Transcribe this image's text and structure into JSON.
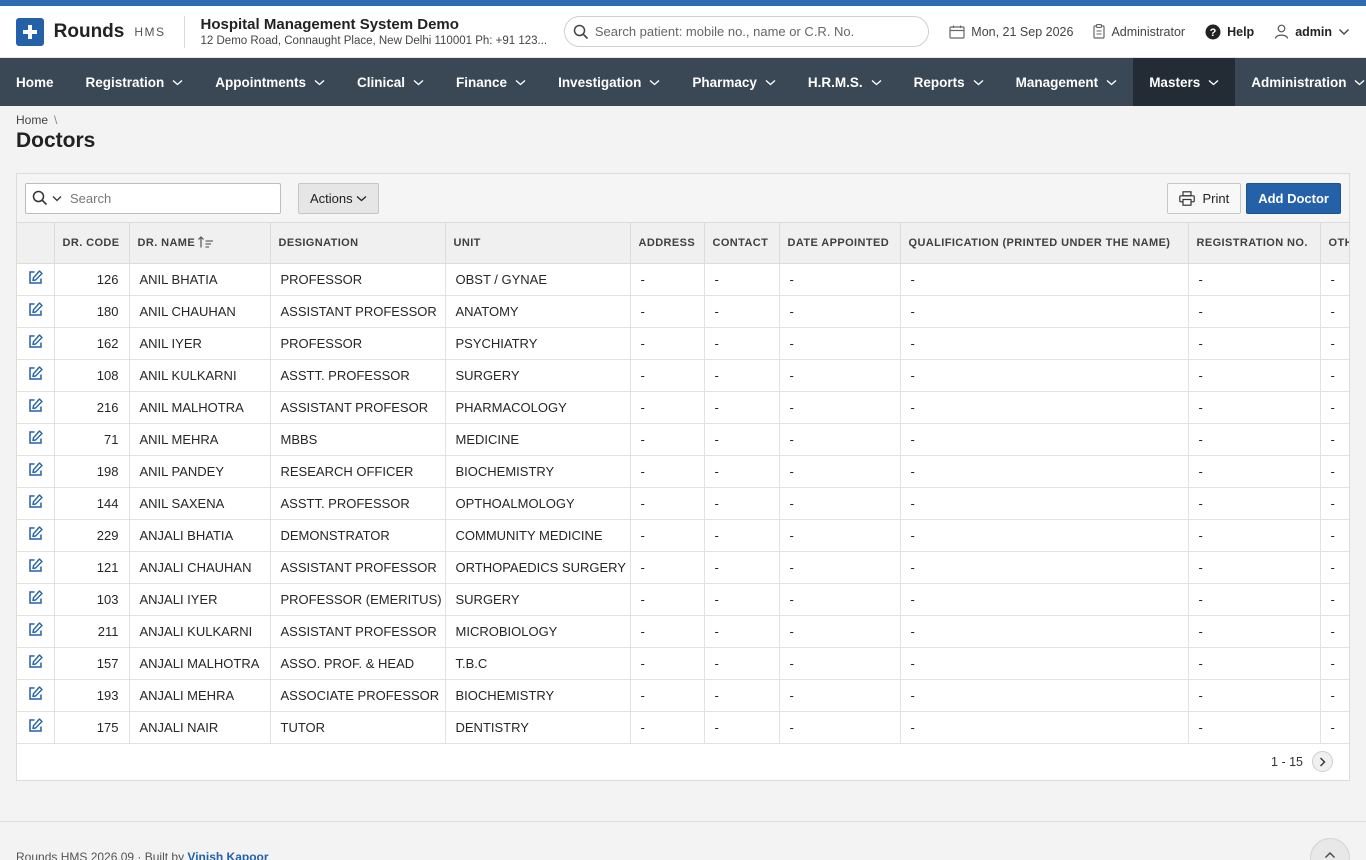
{
  "app": {
    "name": "Rounds",
    "suffix": "HMS"
  },
  "hospital": {
    "name": "Hospital Management System Demo",
    "address": "12 Demo Road, Connaught Place, New Delhi 110001 Ph: +91 123..."
  },
  "header": {
    "search_placeholder": "Search patient: mobile no., name or C.R. No.",
    "date": "Mon, 21 Sep 2026",
    "role": "Administrator",
    "help": "Help",
    "user": "admin"
  },
  "nav": {
    "items": [
      {
        "label": "Home",
        "caret": false,
        "active": false
      },
      {
        "label": "Registration",
        "caret": true,
        "active": false
      },
      {
        "label": "Appointments",
        "caret": true,
        "active": false
      },
      {
        "label": "Clinical",
        "caret": true,
        "active": false
      },
      {
        "label": "Finance",
        "caret": true,
        "active": false
      },
      {
        "label": "Investigation",
        "caret": true,
        "active": false
      },
      {
        "label": "Pharmacy",
        "caret": true,
        "active": false
      },
      {
        "label": "H.R.M.S.",
        "caret": true,
        "active": false
      },
      {
        "label": "Reports",
        "caret": true,
        "active": false
      },
      {
        "label": "Management",
        "caret": true,
        "active": false
      },
      {
        "label": "Masters",
        "caret": true,
        "active": true
      },
      {
        "label": "Administration",
        "caret": true,
        "active": false
      }
    ]
  },
  "breadcrumb": {
    "home": "Home",
    "separator": "\\"
  },
  "page": {
    "title": "Doctors"
  },
  "toolbar": {
    "search_placeholder": "Search",
    "actions": "Actions",
    "print": "Print",
    "add": "Add Doctor"
  },
  "table": {
    "columns": [
      "DR. CODE",
      "DR. NAME",
      "DESIGNATION",
      "UNIT",
      "ADDRESS",
      "CONTACT",
      "DATE APPOINTED",
      "QUALIFICATION (PRINTED UNDER THE NAME)",
      "REGISTRATION NO.",
      "OTHER"
    ],
    "sorted_column": "DR. NAME",
    "rows": [
      [
        "126",
        "ANIL BHATIA",
        "PROFESSOR",
        "OBST / GYNAE",
        "-",
        "-",
        "-",
        "-",
        "-",
        "-"
      ],
      [
        "180",
        "ANIL CHAUHAN",
        "ASSISTANT PROFESSOR",
        "ANATOMY",
        "-",
        "-",
        "-",
        "-",
        "-",
        "-"
      ],
      [
        "162",
        "ANIL IYER",
        "PROFESSOR",
        "PSYCHIATRY",
        "-",
        "-",
        "-",
        "-",
        "-",
        "-"
      ],
      [
        "108",
        "ANIL KULKARNI",
        "ASSTT. PROFESSOR",
        "SURGERY",
        "-",
        "-",
        "-",
        "-",
        "-",
        "-"
      ],
      [
        "216",
        "ANIL MALHOTRA",
        "ASSISTANT PROFESOR",
        "PHARMACOLOGY",
        "-",
        "-",
        "-",
        "-",
        "-",
        "-"
      ],
      [
        "71",
        "ANIL MEHRA",
        "MBBS",
        "MEDICINE",
        "-",
        "-",
        "-",
        "-",
        "-",
        "-"
      ],
      [
        "198",
        "ANIL PANDEY",
        "RESEARCH OFFICER",
        "BIOCHEMISTRY",
        "-",
        "-",
        "-",
        "-",
        "-",
        "-"
      ],
      [
        "144",
        "ANIL SAXENA",
        "ASSTT. PROFESSOR",
        "OPTHOALMOLOGY",
        "-",
        "-",
        "-",
        "-",
        "-",
        "-"
      ],
      [
        "229",
        "ANJALI BHATIA",
        "DEMONSTRATOR",
        "COMMUNITY MEDICINE",
        "-",
        "-",
        "-",
        "-",
        "-",
        "-"
      ],
      [
        "121",
        "ANJALI CHAUHAN",
        "ASSISTANT PROFESSOR",
        "ORTHOPAEDICS SURGERY",
        "-",
        "-",
        "-",
        "-",
        "-",
        "-"
      ],
      [
        "103",
        "ANJALI IYER",
        "PROFESSOR (EMERITUS)",
        "SURGERY",
        "-",
        "-",
        "-",
        "-",
        "-",
        "-"
      ],
      [
        "211",
        "ANJALI KULKARNI",
        "ASSISTANT PROFESSOR",
        "MICROBIOLOGY",
        "-",
        "-",
        "-",
        "-",
        "-",
        "-"
      ],
      [
        "157",
        "ANJALI MALHOTRA",
        "ASSO. PROF. & HEAD",
        "T.B.C",
        "-",
        "-",
        "-",
        "-",
        "-",
        "-"
      ],
      [
        "193",
        "ANJALI MEHRA",
        "ASSOCIATE PROFESSOR",
        "BIOCHEMISTRY",
        "-",
        "-",
        "-",
        "-",
        "-",
        "-"
      ],
      [
        "175",
        "ANJALI NAIR",
        "TUTOR",
        "DENTISTRY",
        "-",
        "-",
        "-",
        "-",
        "-",
        "-"
      ]
    ]
  },
  "pagination": {
    "range": "1 - 15"
  },
  "footer": {
    "text": "Rounds HMS 2026.09 · Built by ",
    "author": "Vinish Kapoor"
  },
  "colors": {
    "brand": "#2461a8",
    "stripe": "#2d6cb3",
    "nav_bg": "#3a4754",
    "nav_active": "#232c35"
  },
  "icons": {
    "logo": "plus-icon",
    "search": "search-icon",
    "calendar": "calendar-icon",
    "role": "clipboard-icon",
    "help": "help-icon",
    "user": "user-icon",
    "edit": "edit-icon",
    "print": "printer-icon",
    "next": "chevron-right-icon",
    "top": "chevron-up-icon"
  }
}
